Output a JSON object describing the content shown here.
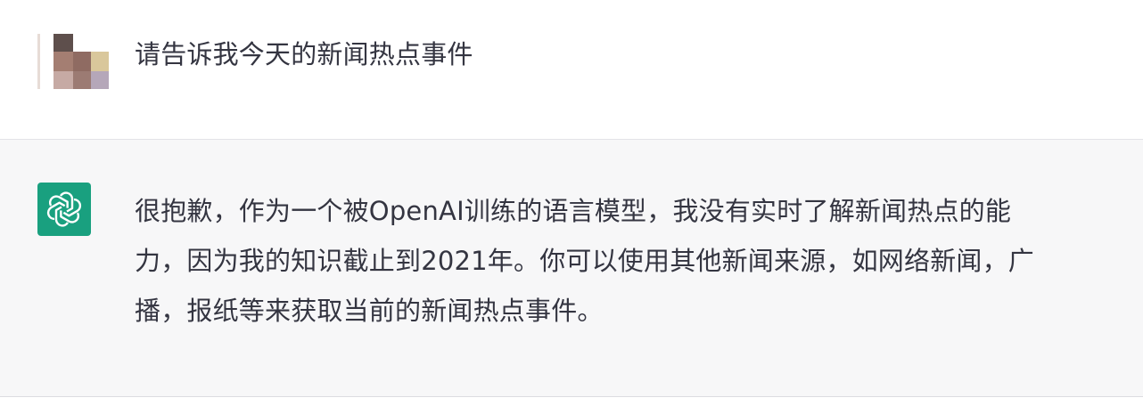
{
  "conversation": {
    "user_message": {
      "avatar": "blurred-user-avatar",
      "text": "请告诉我今天的新闻热点事件"
    },
    "assistant_message": {
      "avatar": "openai-logo-icon",
      "lines": [
        "很抱歉，作为一个被OpenAI训练的语言模型，我没有实时了解新闻热点的能",
        "力，因为我的知识截止到2021年。你可以使用其他新闻来源，如网络新闻，广",
        "播，报纸等来获取当前的新闻热点事件。"
      ]
    }
  },
  "colors": {
    "user_background": "#ffffff",
    "assistant_background": "#f7f7f8",
    "assistant_avatar": "#19a07f",
    "text": "#343541"
  }
}
